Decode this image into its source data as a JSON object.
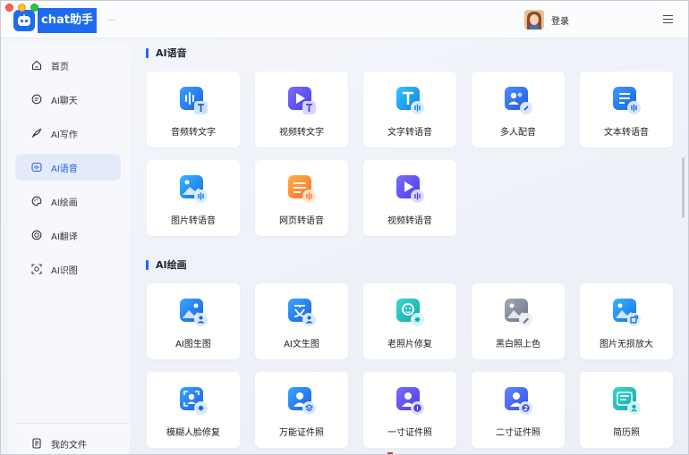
{
  "app": {
    "brand_name": "chat助手",
    "login_label": "登录"
  },
  "colors": {
    "accent": "#1e6bf0",
    "active_bg": "#e3ebfb"
  },
  "sidebar": {
    "items": [
      {
        "label": "首页",
        "icon": "home-icon"
      },
      {
        "label": "AI聊天",
        "icon": "chat-bubble-icon"
      },
      {
        "label": "AI写作",
        "icon": "quill-icon"
      },
      {
        "label": "AI语音",
        "icon": "voice-icon",
        "active": true
      },
      {
        "label": "AI绘画",
        "icon": "palette-icon"
      },
      {
        "label": "AI翻译",
        "icon": "translate-icon"
      },
      {
        "label": "AI识图",
        "icon": "scan-icon"
      }
    ],
    "bottom_item": {
      "label": "我的文件",
      "icon": "file-icon"
    }
  },
  "sections": [
    {
      "title": "AI语音",
      "cards": [
        {
          "label": "音频转文字",
          "icon": "audio-to-text-icon"
        },
        {
          "label": "视频转文字",
          "icon": "video-to-text-icon"
        },
        {
          "label": "文字转语音",
          "icon": "text-to-speech-icon"
        },
        {
          "label": "多人配音",
          "icon": "multi-dubbing-icon"
        },
        {
          "label": "文本转语音",
          "icon": "document-to-speech-icon"
        },
        {
          "label": "图片转语音",
          "icon": "image-to-speech-icon"
        },
        {
          "label": "网页转语音",
          "icon": "webpage-to-speech-icon"
        },
        {
          "label": "视频转语音",
          "icon": "video-to-speech-icon"
        }
      ]
    },
    {
      "title": "AI绘画",
      "cards": [
        {
          "label": "AI图生图",
          "icon": "image-to-image-icon"
        },
        {
          "label": "AI文生图",
          "icon": "text-to-image-icon"
        },
        {
          "label": "老照片修复",
          "icon": "old-photo-restore-icon"
        },
        {
          "label": "黑白照上色",
          "icon": "bw-colorize-icon"
        },
        {
          "label": "图片无损放大",
          "icon": "image-upscale-icon"
        },
        {
          "label": "模糊人脸修复",
          "icon": "face-restore-icon"
        },
        {
          "label": "万能证件照",
          "icon": "id-photo-icon"
        },
        {
          "label": "一寸证件照",
          "icon": "one-inch-photo-icon"
        },
        {
          "label": "二寸证件照",
          "icon": "two-inch-photo-icon"
        },
        {
          "label": "简历照",
          "icon": "resume-photo-icon"
        }
      ]
    }
  ]
}
